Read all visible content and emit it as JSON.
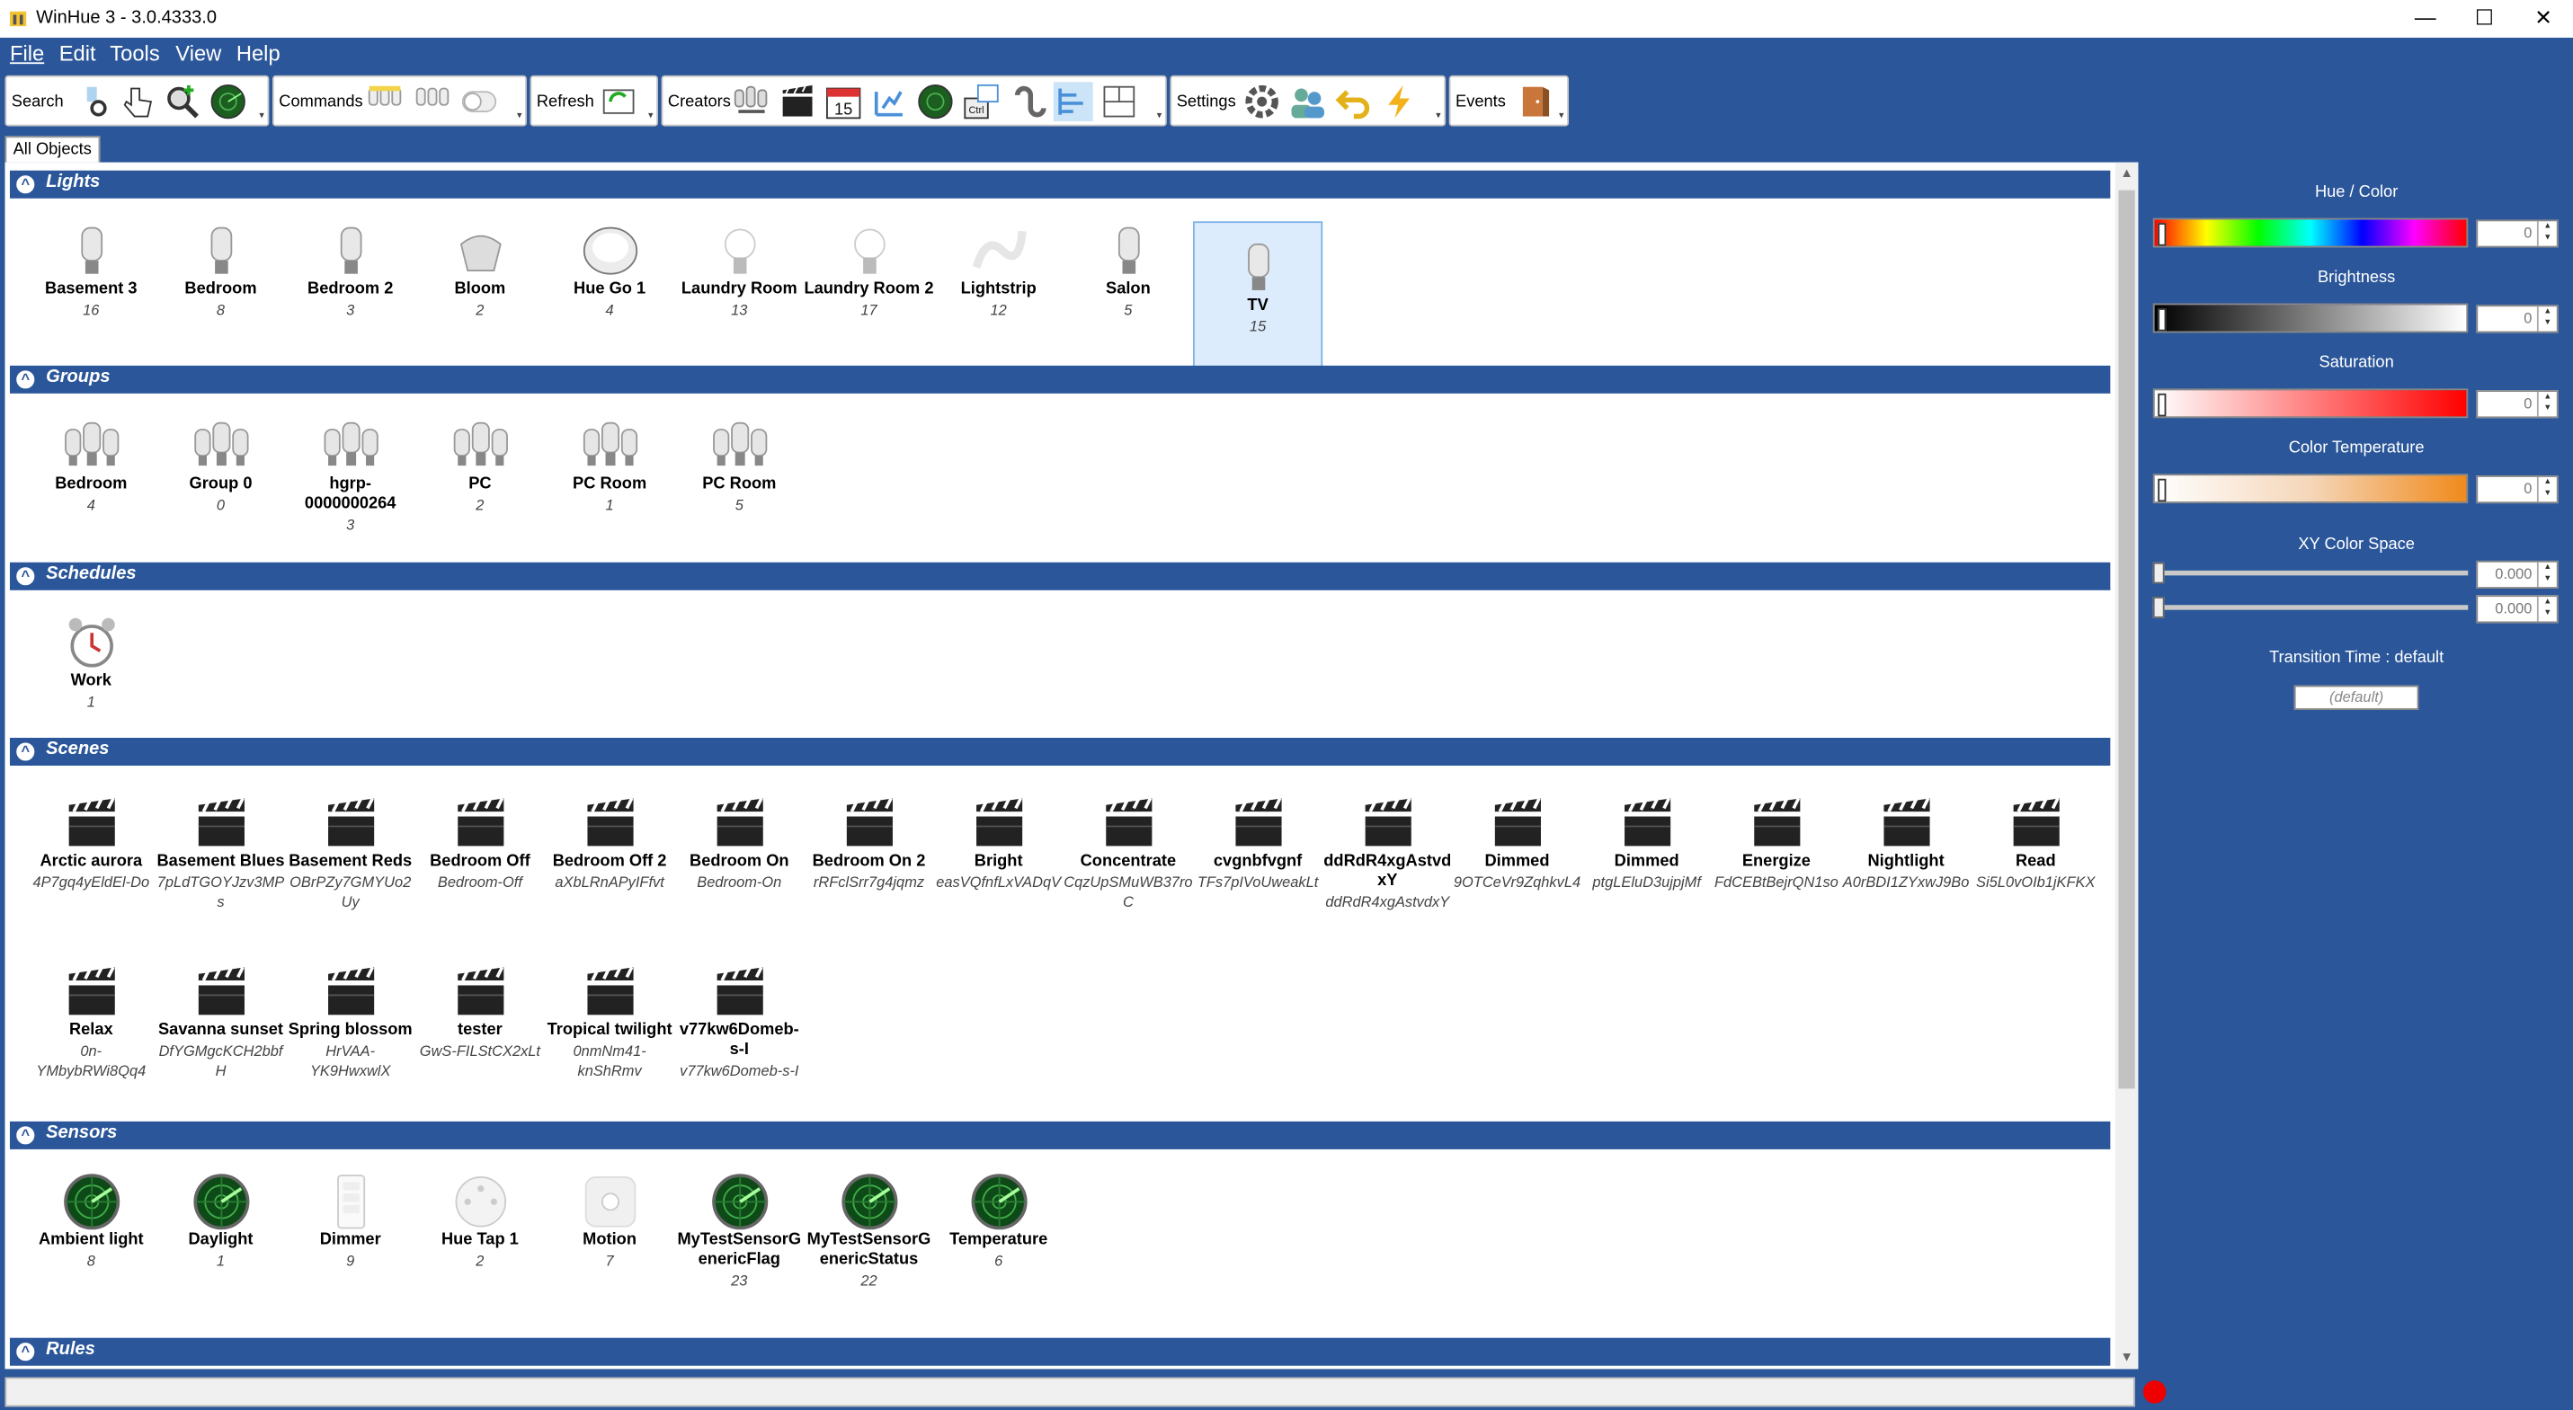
{
  "window": {
    "title": "WinHue 3 - 3.0.4333.0",
    "minimize": "—",
    "maximize": "☐",
    "close": "✕"
  },
  "menu": [
    "File",
    "Edit",
    "Tools",
    "View",
    "Help"
  ],
  "toolbar": {
    "search": "Search",
    "commands": "Commands",
    "refresh": "Refresh",
    "creators": "Creators",
    "settings": "Settings",
    "events": "Events"
  },
  "tab": "All Objects",
  "sections": {
    "lights": {
      "title": "Lights",
      "items": [
        {
          "name": "Basement 3",
          "id": "16",
          "icon": "bulb-icon"
        },
        {
          "name": "Bedroom",
          "id": "8",
          "icon": "bulb-icon"
        },
        {
          "name": "Bedroom 2",
          "id": "3",
          "icon": "bulb-icon"
        },
        {
          "name": "Bloom",
          "id": "2",
          "icon": "bloom-icon"
        },
        {
          "name": "Hue Go 1",
          "id": "4",
          "icon": "huego-icon"
        },
        {
          "name": "Laundry Room",
          "id": "13",
          "icon": "white-bulb-icon"
        },
        {
          "name": "Laundry Room 2",
          "id": "17",
          "icon": "white-bulb-icon"
        },
        {
          "name": "Lightstrip",
          "id": "12",
          "icon": "lightstrip-icon"
        },
        {
          "name": "Salon",
          "id": "5",
          "icon": "bulb-icon"
        },
        {
          "name": "TV",
          "id": "15",
          "icon": "bulb-icon"
        }
      ]
    },
    "groups": {
      "title": "Groups",
      "items": [
        {
          "name": "Bedroom",
          "id": "4"
        },
        {
          "name": "Group 0",
          "id": "0"
        },
        {
          "name": "hgrp-0000000264",
          "id": "3"
        },
        {
          "name": "PC",
          "id": "2"
        },
        {
          "name": "PC Room",
          "id": "1"
        },
        {
          "name": "PC Room",
          "id": "5"
        }
      ]
    },
    "schedules": {
      "title": "Schedules",
      "items": [
        {
          "name": "Work",
          "id": "1"
        }
      ]
    },
    "scenes": {
      "title": "Scenes",
      "items": [
        {
          "name": "Arctic aurora",
          "id": "4P7gq4yEldEl-Do"
        },
        {
          "name": "Basement Blues",
          "id": "7pLdTGOYJzv3MPs"
        },
        {
          "name": "Basement Reds",
          "id": "OBrPZy7GMYUo2Uy"
        },
        {
          "name": "Bedroom Off",
          "id": "Bedroom-Off"
        },
        {
          "name": "Bedroom Off 2",
          "id": "aXbLRnAPyIFfvt"
        },
        {
          "name": "Bedroom On",
          "id": "Bedroom-On"
        },
        {
          "name": "Bedroom On 2",
          "id": "rRFclSrr7g4jqmz"
        },
        {
          "name": "Bright",
          "id": "easVQfnfLxVADqV"
        },
        {
          "name": "Concentrate",
          "id": "CqzUpSMuWB37roC"
        },
        {
          "name": "cvgnbfvgnf",
          "id": "TFs7pIVoUweakLt"
        },
        {
          "name": "ddRdR4xgAstvdxY",
          "id": "ddRdR4xgAstvdxY"
        },
        {
          "name": "Dimmed",
          "id": "9OTCeVr9ZqhkvL4"
        },
        {
          "name": "Dimmed",
          "id": "ptgLEluD3ujpjMf"
        },
        {
          "name": "Energize",
          "id": "FdCEBtBejrQN1so"
        },
        {
          "name": "Nightlight",
          "id": "A0rBDI1ZYxwJ9Bo"
        },
        {
          "name": "Read",
          "id": "Si5L0vOIb1jKFKX"
        },
        {
          "name": "Relax",
          "id": "0n-YMbybRWi8Qq4"
        },
        {
          "name": "Savanna sunset",
          "id": "DfYGMgcKCH2bbfH"
        },
        {
          "name": "Spring blossom",
          "id": "HrVAA-YK9HwxwlX"
        },
        {
          "name": "tester",
          "id": "GwS-FILStCX2xLt"
        },
        {
          "name": "Tropical twilight",
          "id": "0nmNm41-knShRmv"
        },
        {
          "name": "v77kw6Domeb-s-I",
          "id": "v77kw6Domeb-s-I"
        }
      ]
    },
    "sensors": {
      "title": "Sensors",
      "items": [
        {
          "name": "Ambient light",
          "id": "8",
          "icon": "radar-icon"
        },
        {
          "name": "Daylight",
          "id": "1",
          "icon": "radar-icon"
        },
        {
          "name": "Dimmer",
          "id": "9",
          "icon": "dimmer-switch-icon"
        },
        {
          "name": "Hue Tap 1",
          "id": "2",
          "icon": "hue-tap-icon"
        },
        {
          "name": "Motion",
          "id": "7",
          "icon": "motion-sensor-icon"
        },
        {
          "name": "MyTestSensorGenericFlag",
          "id": "23",
          "icon": "radar-icon"
        },
        {
          "name": "MyTestSensorGenericStatus",
          "id": "22",
          "icon": "radar-icon"
        },
        {
          "name": "Temperature",
          "id": "6",
          "icon": "radar-icon"
        }
      ]
    },
    "rules": {
      "title": "Rules"
    }
  },
  "panel": {
    "hue_label": "Hue / Color",
    "hue_value": "0",
    "brightness_label": "Brightness",
    "brightness_value": "0",
    "saturation_label": "Saturation",
    "saturation_value": "0",
    "ct_label": "Color Temperature",
    "ct_value": "0",
    "xy_label": "XY Color Space",
    "x_value": "0.000",
    "y_value": "0.000",
    "transition_label": "Transition Time : default",
    "transition_value": "(default)"
  },
  "colors": {
    "accent": "#2b579a",
    "selected": "#dcecfc",
    "status_dot": "#ee0000"
  }
}
